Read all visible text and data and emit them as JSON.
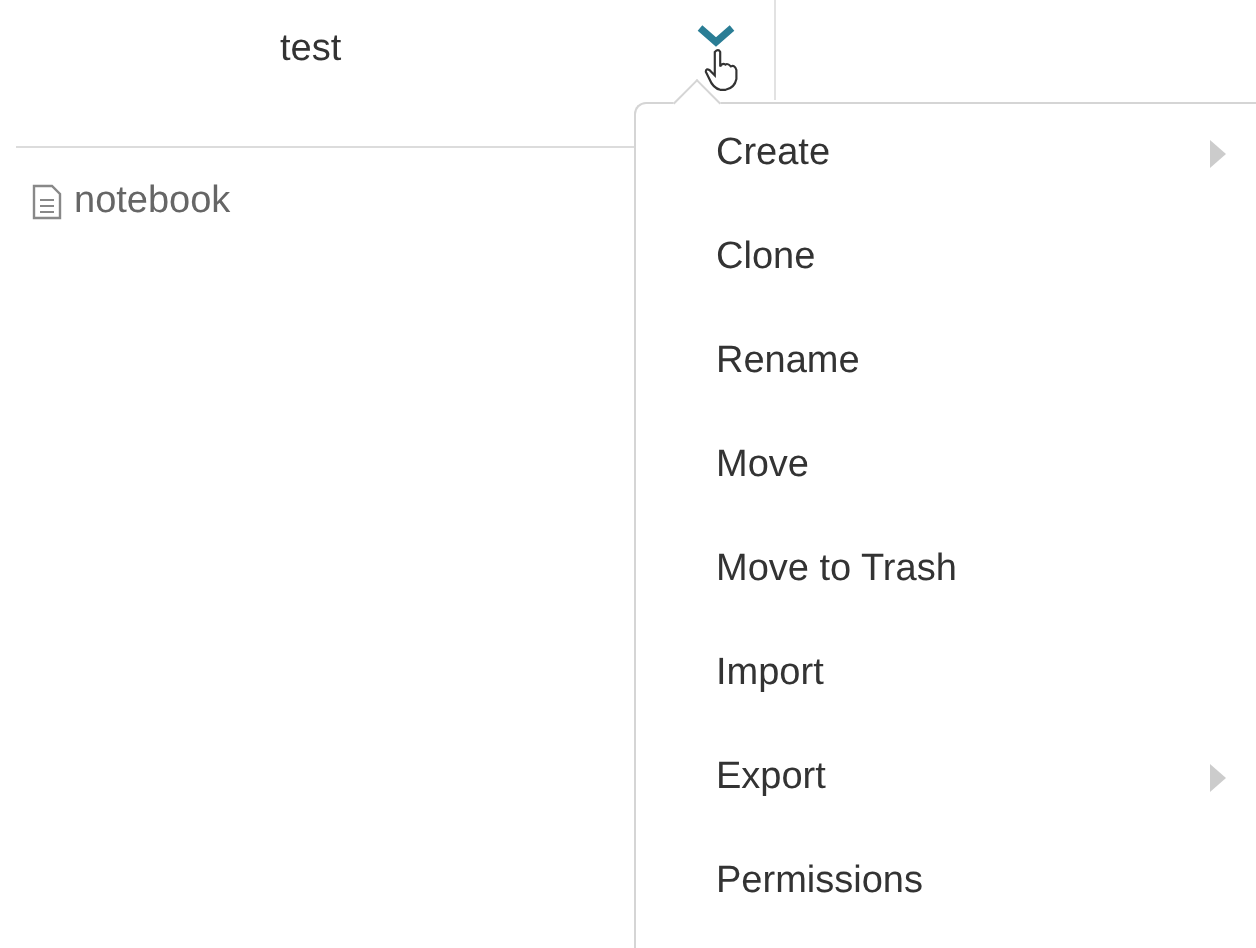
{
  "header": {
    "title": "test"
  },
  "tree": {
    "items": [
      {
        "label": "notebook",
        "kind": "notebook"
      }
    ]
  },
  "menu": {
    "items": [
      {
        "label": "Create",
        "has_submenu": true
      },
      {
        "label": "Clone",
        "has_submenu": false
      },
      {
        "label": "Rename",
        "has_submenu": false
      },
      {
        "label": "Move",
        "has_submenu": false
      },
      {
        "label": "Move to Trash",
        "has_submenu": false
      },
      {
        "label": "Import",
        "has_submenu": false
      },
      {
        "label": "Export",
        "has_submenu": true
      },
      {
        "label": "Permissions",
        "has_submenu": false
      }
    ]
  }
}
